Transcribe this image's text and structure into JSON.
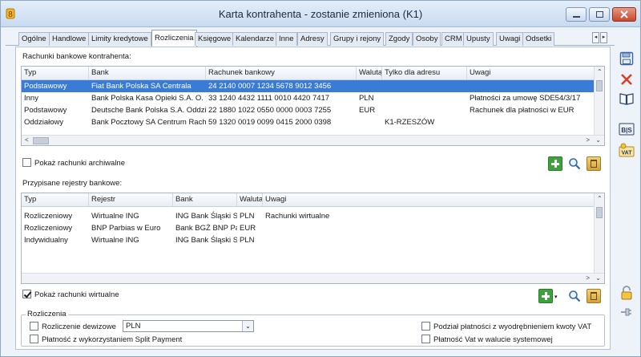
{
  "window": {
    "title": "Karta kontrahenta - zostanie zmieniona (K1)"
  },
  "tabs": [
    {
      "label": "Ogólne"
    },
    {
      "label": "Handlowe"
    },
    {
      "label": "Limity kredytowe"
    },
    {
      "label": "Rozliczenia",
      "active": true
    },
    {
      "label": "Księgowe"
    },
    {
      "label": "Kalendarze"
    },
    {
      "label": "Inne"
    },
    {
      "label": "Adresy"
    },
    {
      "label": "Grupy i rejony"
    },
    {
      "label": "Zgody"
    },
    {
      "label": "Osoby"
    },
    {
      "label": "CRM"
    },
    {
      "label": "Upusty"
    },
    {
      "label": "Uwagi"
    },
    {
      "label": "Odsetki"
    }
  ],
  "accounts": {
    "label": "Rachunki bankowe kontrahenta:",
    "headers": [
      "Typ",
      "Bank",
      "Rachunek bankowy",
      "Walutą",
      "Tylko dla adresu",
      "Uwagi"
    ],
    "rows": [
      [
        "Podstawowy",
        "Fiat Bank Polska SA Centrala",
        "24 2140 0007 1234 5678 9012 3456",
        "",
        "",
        ""
      ],
      [
        "Inny",
        "Bank Polska Kasa Opieki S.A. O. w",
        "33 1240 4432 1111 0010 4420 7417",
        "PLN",
        "",
        "Płatności za umowę SDE54/3/17"
      ],
      [
        "Podstawowy",
        "Deutsche Bank Polska S.A. Oddzia",
        "22 1880 1022 0550 0000 0003 7255",
        "EUR",
        "",
        "Rachunek dla płatności w EUR"
      ],
      [
        "Oddziałowy",
        "Bank Pocztowy SA Centrum Rachu",
        "59 1320 0019 0099 0415 2000 0398",
        "",
        "K1-RZESZÓW",
        ""
      ]
    ],
    "show_archived_label": "Pokaż rachunki archiwalne"
  },
  "registers": {
    "label": "Przypisane rejestry bankowe:",
    "headers": [
      "Typ",
      "Rejestr",
      "Bank",
      "Waluta",
      "Uwagi"
    ],
    "rows": [
      [
        "Rozliczeniowy",
        "Wirtualne ING",
        "ING Bank Śląski S..",
        "PLN",
        "Rachunki wirtualne"
      ],
      [
        "Rozliczeniowy",
        "BNP Parbias w Euro",
        "Bank BGŻ BNP Pari",
        "EUR",
        ""
      ],
      [
        "Indywidualny",
        "Wirtualne ING",
        "ING Bank Śląski S..",
        "PLN",
        ""
      ]
    ],
    "show_virtual_label": "Pokaż rachunki wirtualne",
    "show_virtual_checked": true
  },
  "settlements": {
    "group_label": "Rozliczenia",
    "currency_settlement_label": "Rozliczenie dewizowe",
    "currency_value": "PLN",
    "split_payment_label": "Płatność z wykorzystaniem Split Payment",
    "vat_split_label": "Podział płatności z wyodrębnieniem kwoty VAT",
    "vat_system_currency_label": "Płatność Vat w walucie systemowej"
  },
  "colors": {
    "selection": "#3a7bd5",
    "accent_green": "#3da23d"
  }
}
